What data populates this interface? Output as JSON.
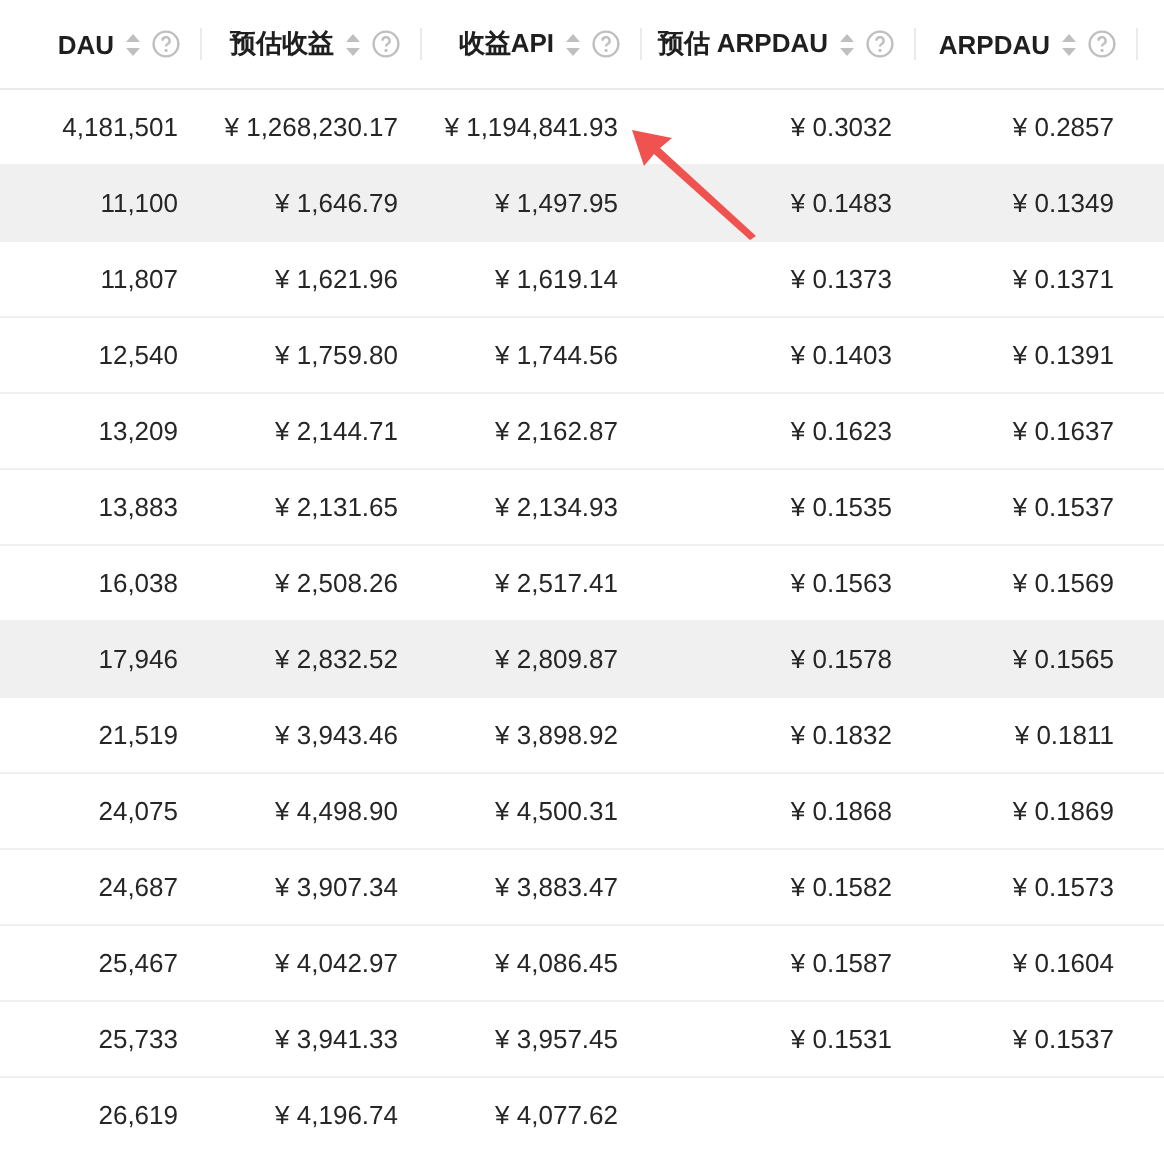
{
  "table": {
    "columns": [
      {
        "label": "DAU"
      },
      {
        "label": "预估收益"
      },
      {
        "label": "收益API"
      },
      {
        "label": "预估 ARPDAU"
      },
      {
        "label": "ARPDAU"
      }
    ],
    "rows": [
      {
        "highlighted": false,
        "cells": [
          "4,181,501",
          "¥ 1,268,230.17",
          "¥ 1,194,841.93",
          "¥ 0.3032",
          "¥ 0.2857"
        ]
      },
      {
        "highlighted": true,
        "cells": [
          "11,100",
          "¥ 1,646.79",
          "¥ 1,497.95",
          "¥ 0.1483",
          "¥ 0.1349"
        ]
      },
      {
        "highlighted": false,
        "cells": [
          "11,807",
          "¥ 1,621.96",
          "¥ 1,619.14",
          "¥ 0.1373",
          "¥ 0.1371"
        ]
      },
      {
        "highlighted": false,
        "cells": [
          "12,540",
          "¥ 1,759.80",
          "¥ 1,744.56",
          "¥ 0.1403",
          "¥ 0.1391"
        ]
      },
      {
        "highlighted": false,
        "cells": [
          "13,209",
          "¥ 2,144.71",
          "¥ 2,162.87",
          "¥ 0.1623",
          "¥ 0.1637"
        ]
      },
      {
        "highlighted": false,
        "cells": [
          "13,883",
          "¥ 2,131.65",
          "¥ 2,134.93",
          "¥ 0.1535",
          "¥ 0.1537"
        ]
      },
      {
        "highlighted": false,
        "cells": [
          "16,038",
          "¥ 2,508.26",
          "¥ 2,517.41",
          "¥ 0.1563",
          "¥ 0.1569"
        ]
      },
      {
        "highlighted": true,
        "cells": [
          "17,946",
          "¥ 2,832.52",
          "¥ 2,809.87",
          "¥ 0.1578",
          "¥ 0.1565"
        ]
      },
      {
        "highlighted": false,
        "cells": [
          "21,519",
          "¥ 3,943.46",
          "¥ 3,898.92",
          "¥ 0.1832",
          "¥ 0.1811"
        ]
      },
      {
        "highlighted": false,
        "cells": [
          "24,075",
          "¥ 4,498.90",
          "¥ 4,500.31",
          "¥ 0.1868",
          "¥ 0.1869"
        ]
      },
      {
        "highlighted": false,
        "cells": [
          "24,687",
          "¥ 3,907.34",
          "¥ 3,883.47",
          "¥ 0.1582",
          "¥ 0.1573"
        ]
      },
      {
        "highlighted": false,
        "cells": [
          "25,467",
          "¥ 4,042.97",
          "¥ 4,086.45",
          "¥ 0.1587",
          "¥ 0.1604"
        ]
      },
      {
        "highlighted": false,
        "cells": [
          "25,733",
          "¥ 3,941.33",
          "¥ 3,957.45",
          "¥ 0.1531",
          "¥ 0.1537"
        ]
      },
      {
        "highlighted": false,
        "cells": [
          "26,619",
          "¥ 4,196.74",
          "¥ 4,077.62"
        ]
      }
    ]
  }
}
